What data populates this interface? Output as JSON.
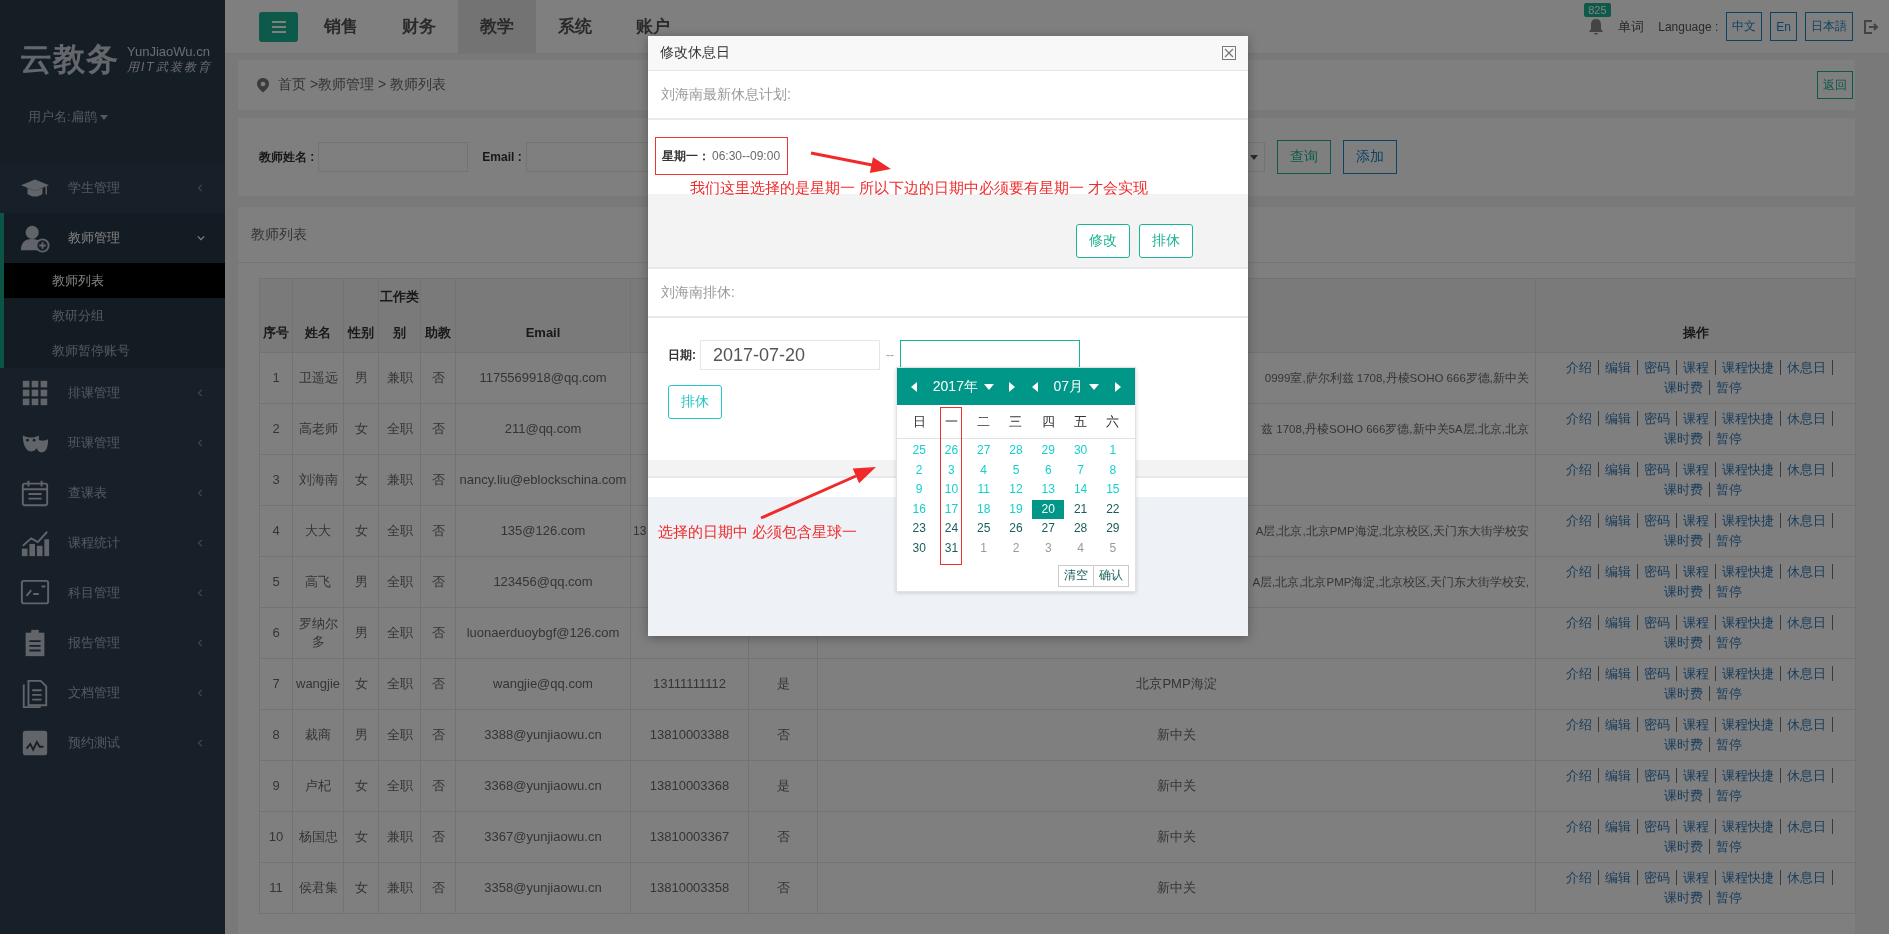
{
  "sidebar": {
    "logo": {
      "title": "云教务",
      "domain": "YunJiaoWu.cn",
      "slogan": "用IT武装教育"
    },
    "user": "用户名:扁鹊",
    "menu": [
      {
        "label": "学生管理",
        "kind": "graduation",
        "expanded": false
      },
      {
        "label": "教师管理",
        "kind": "user_add",
        "expanded": true,
        "children": [
          {
            "label": "教师列表",
            "selected": true
          },
          {
            "label": "教研分组",
            "selected": false
          },
          {
            "label": "教师暂停账号",
            "selected": false
          }
        ]
      },
      {
        "label": "排课管理",
        "kind": "grid",
        "expanded": false
      },
      {
        "label": "班课管理",
        "kind": "mask",
        "expanded": false
      },
      {
        "label": "查课表",
        "kind": "calendar",
        "expanded": false
      },
      {
        "label": "课程统计",
        "kind": "chart",
        "expanded": false
      },
      {
        "label": "科目管理",
        "kind": "board",
        "expanded": false
      },
      {
        "label": "报告管理",
        "kind": "clipboard",
        "expanded": false
      },
      {
        "label": "文档管理",
        "kind": "document",
        "expanded": false
      },
      {
        "label": "预约测试",
        "kind": "test",
        "expanded": false
      }
    ]
  },
  "topbar": {
    "tabs": [
      {
        "label": "销售",
        "selected": false
      },
      {
        "label": "财务",
        "selected": false
      },
      {
        "label": "教学",
        "selected": true
      },
      {
        "label": "系统",
        "selected": false
      },
      {
        "label": "账户",
        "selected": false
      }
    ],
    "notifications": "825",
    "words_link": "单词",
    "language_label": "Language :",
    "languages": [
      "中文",
      "En",
      "日本語"
    ]
  },
  "breadcrumb": "首页 >教师管理 > 教师列表",
  "back_button": "返回",
  "search": {
    "fields": [
      {
        "label": "教师姓名 :"
      },
      {
        "label": "Email :"
      }
    ],
    "buttons": [
      "查询",
      "添加"
    ]
  },
  "panel_title": "教师列表",
  "table": {
    "columns": [
      {
        "label": "序号"
      },
      {
        "label": "姓名"
      },
      {
        "label": "性别"
      },
      {
        "label": "工作类别"
      },
      {
        "label": "助教"
      },
      {
        "label": "Email"
      },
      {},
      {},
      {},
      {
        "label": "操作"
      }
    ],
    "rows": [
      {
        "no": "1",
        "name": "卫遥远",
        "gender": "男",
        "type": "兼职",
        "assistant": "否",
        "email": "1175569918@qq.com",
        "column_9": "0999室,萨尔利兹 1708,丹棱SOHO 666罗德,新中关",
        "actions": [
          "介绍",
          "编辑",
          "密码",
          "课程",
          "课程快捷",
          "休息日",
          "课时费",
          "暂停"
        ]
      },
      {
        "no": "2",
        "name": "高老师",
        "gender": "女",
        "type": "全职",
        "assistant": "否",
        "email": "211@qq.com",
        "column_9": "兹 1708,丹棱SOHO 666罗德,新中关5A层,北京,北京",
        "actions": [
          "介绍",
          "编辑",
          "密码",
          "课程",
          "课程快捷",
          "休息日",
          "课时费",
          "暂停"
        ]
      },
      {
        "no": "3",
        "name": "刘海南",
        "gender": "女",
        "type": "兼职",
        "assistant": "否",
        "email": "nancy.liu@eblockschina.com",
        "actions": [
          "介绍",
          "编辑",
          "密码",
          "课程",
          "课程快捷",
          "休息日",
          "课时费",
          "暂停"
        ]
      },
      {
        "no": "4",
        "name": "大大",
        "gender": "女",
        "type": "全职",
        "assistant": "否",
        "email": "135@126.com",
        "column_7": "13",
        "column_9": "A层,北京,北京PMP海淀,北京校区,天门东大街学校安",
        "actions": [
          "介绍",
          "编辑",
          "密码",
          "课程",
          "课程快捷",
          "休息日",
          "课时费",
          "暂停"
        ]
      },
      {
        "no": "5",
        "name": "高飞",
        "gender": "男",
        "type": "全职",
        "assistant": "否",
        "email": "123456@qq.com",
        "column_9": "A层,北京,北京PMP海淀,北京校区,天门东大街学校安,",
        "actions": [
          "介绍",
          "编辑",
          "密码",
          "课程",
          "课程快捷",
          "休息日",
          "课时费",
          "暂停"
        ]
      },
      {
        "no": "6",
        "name": "罗纳尔多",
        "gender": "男",
        "type": "全职",
        "assistant": "否",
        "email": "luonaerduoybgf@126.com",
        "actions": [
          "介绍",
          "编辑",
          "密码",
          "课程",
          "课程快捷",
          "休息日",
          "课时费",
          "暂停"
        ]
      },
      {
        "no": "7",
        "name": "wangjie",
        "gender": "女",
        "type": "全职",
        "assistant": "否",
        "email": "wangjie@qq.com",
        "column_7": "13111111112",
        "column_8": "是",
        "column_9": "北京PMP海淀",
        "actions": [
          "介绍",
          "编辑",
          "密码",
          "课程",
          "课程快捷",
          "休息日",
          "课时费",
          "暂停"
        ]
      },
      {
        "no": "8",
        "name": "裁商",
        "gender": "男",
        "type": "全职",
        "assistant": "否",
        "email": "3388@yunjiaowu.cn",
        "column_7": "13810003388",
        "column_8": "否",
        "column_9": "新中关",
        "actions": [
          "介绍",
          "编辑",
          "密码",
          "课程",
          "课程快捷",
          "休息日",
          "课时费",
          "暂停"
        ]
      },
      {
        "no": "9",
        "name": "卢杞",
        "gender": "女",
        "type": "全职",
        "assistant": "否",
        "email": "3368@yunjiaowu.cn",
        "column_7": "13810003368",
        "column_8": "是",
        "column_9": "新中关",
        "actions": [
          "介绍",
          "编辑",
          "密码",
          "课程",
          "课程快捷",
          "休息日",
          "课时费",
          "暂停"
        ]
      },
      {
        "no": "10",
        "name": "杨国忠",
        "gender": "女",
        "type": "兼职",
        "assistant": "否",
        "email": "3367@yunjiaowu.cn",
        "column_7": "13810003367",
        "column_8": "否",
        "column_9": "新中关",
        "actions": [
          "介绍",
          "编辑",
          "密码",
          "课程",
          "课程快捷",
          "休息日",
          "课时费",
          "暂停"
        ]
      },
      {
        "no": "11",
        "name": "侯君集",
        "gender": "女",
        "type": "兼职",
        "assistant": "否",
        "email": "3358@yunjiaowu.cn",
        "column_7": "13810003358",
        "column_8": "否",
        "column_9": "新中关",
        "actions": [
          "介绍",
          "编辑",
          "密码",
          "课程",
          "课程快捷",
          "休息日",
          "课时费",
          "暂停"
        ]
      }
    ]
  },
  "dialog": {
    "title": "修改休息日",
    "plan_heading": "刘海南最新休息计划:",
    "plan": {
      "day": "星期一：",
      "time": "06:30--09:00"
    },
    "plan_buttons": [
      "修改",
      "排休"
    ],
    "schedule_heading": "刘海南排休:",
    "date_label": "日期:",
    "start_date": "2017-07-20",
    "range_separator": "--",
    "submit": "排休"
  },
  "date_picker": {
    "year": "2017年",
    "month": "07月",
    "weekdays": [
      "日",
      "一",
      "二",
      "三",
      "四",
      "五",
      "六"
    ],
    "days": [
      {
        "label": "25",
        "kind": "before",
        "selected": false
      },
      {
        "label": "26",
        "kind": "before",
        "selected": false
      },
      {
        "label": "27",
        "kind": "before",
        "selected": false
      },
      {
        "label": "28",
        "kind": "before",
        "selected": false
      },
      {
        "label": "29",
        "kind": "before",
        "selected": false
      },
      {
        "label": "30",
        "kind": "before",
        "selected": false
      },
      {
        "label": "1",
        "kind": "before",
        "selected": false
      },
      {
        "label": "2",
        "kind": "before",
        "selected": false
      },
      {
        "label": "3",
        "kind": "before",
        "selected": false
      },
      {
        "label": "4",
        "kind": "before",
        "selected": false
      },
      {
        "label": "5",
        "kind": "before",
        "selected": false
      },
      {
        "label": "6",
        "kind": "before",
        "selected": false
      },
      {
        "label": "7",
        "kind": "before",
        "selected": false
      },
      {
        "label": "8",
        "kind": "before",
        "selected": false
      },
      {
        "label": "9",
        "kind": "before",
        "selected": false
      },
      {
        "label": "10",
        "kind": "before",
        "selected": false
      },
      {
        "label": "11",
        "kind": "before",
        "selected": false
      },
      {
        "label": "12",
        "kind": "before",
        "selected": false
      },
      {
        "label": "13",
        "kind": "before",
        "selected": false
      },
      {
        "label": "14",
        "kind": "before",
        "selected": false
      },
      {
        "label": "15",
        "kind": "before",
        "selected": false
      },
      {
        "label": "16",
        "kind": "before",
        "selected": false
      },
      {
        "label": "17",
        "kind": "before",
        "selected": false
      },
      {
        "label": "18",
        "kind": "before",
        "selected": false
      },
      {
        "label": "19",
        "kind": "before",
        "selected": false
      },
      {
        "label": "20",
        "kind": "normal",
        "selected": true
      },
      {
        "label": "21",
        "kind": "normal",
        "selected": false
      },
      {
        "label": "22",
        "kind": "normal",
        "selected": false
      },
      {
        "label": "23",
        "kind": "normal",
        "selected": false
      },
      {
        "label": "24",
        "kind": "normal",
        "selected": false
      },
      {
        "label": "25",
        "kind": "normal",
        "selected": false
      },
      {
        "label": "26",
        "kind": "normal",
        "selected": false
      },
      {
        "label": "27",
        "kind": "normal",
        "selected": false
      },
      {
        "label": "28",
        "kind": "normal",
        "selected": false
      },
      {
        "label": "29",
        "kind": "normal",
        "selected": false
      },
      {
        "label": "30",
        "kind": "normal",
        "selected": false
      },
      {
        "label": "31",
        "kind": "normal",
        "selected": false
      },
      {
        "label": "1",
        "kind": "next_month",
        "selected": false
      },
      {
        "label": "2",
        "kind": "next_month",
        "selected": false
      },
      {
        "label": "3",
        "kind": "next_month",
        "selected": false
      },
      {
        "label": "4",
        "kind": "next_month",
        "selected": false
      },
      {
        "label": "5",
        "kind": "next_month",
        "selected": false
      }
    ],
    "buttons": [
      "清空",
      "确认"
    ]
  },
  "annotations": [
    {
      "text": "我们这里选择的是星期一  所以下边的日期中必须要有星期一 才会实现"
    },
    {
      "text": "选择的日期中 必须包含星球一"
    }
  ]
}
